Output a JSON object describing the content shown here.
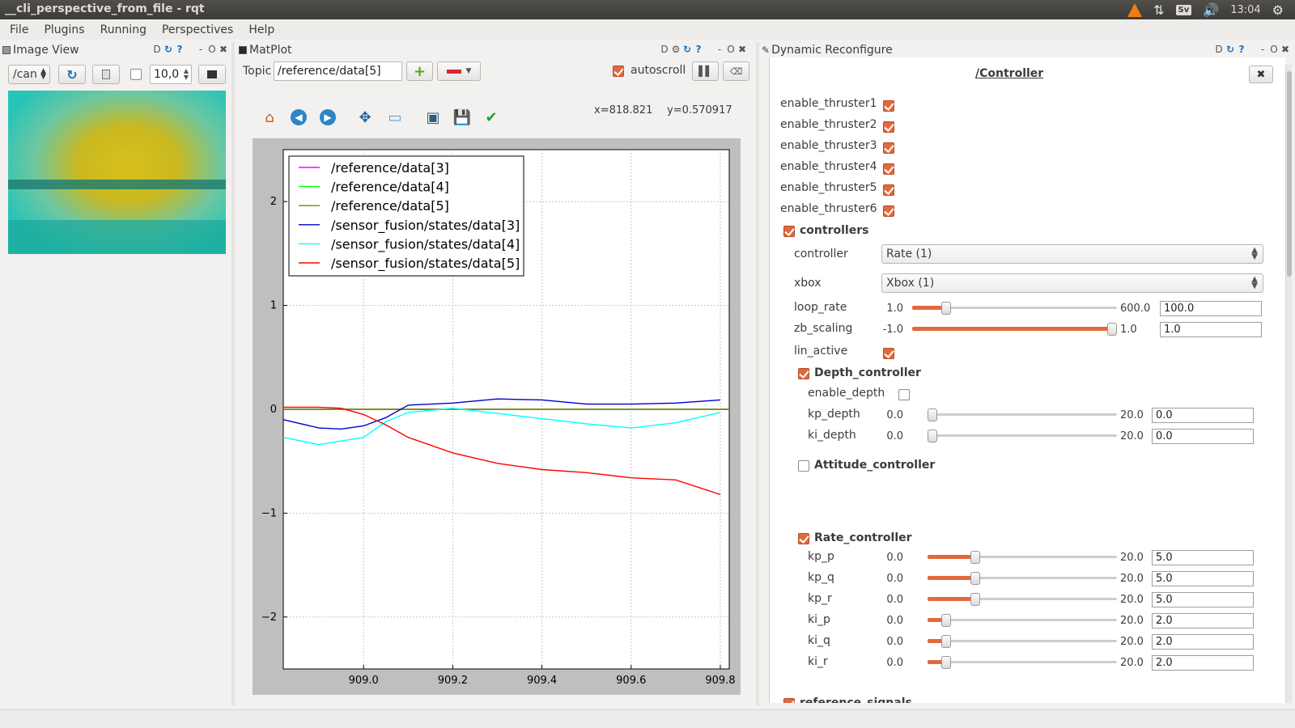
{
  "window": {
    "title": "__cli_perspective_from_file - rqt"
  },
  "tray": {
    "keyboard": "Sv",
    "clock": "13:04"
  },
  "menu": [
    "File",
    "Plugins",
    "Running",
    "Perspectives",
    "Help"
  ],
  "image_view": {
    "title": "Image View",
    "topic": "/can",
    "zoom": "10,0",
    "smooth_checked": false,
    "dock_controls": {
      "d": "D",
      "o": "O",
      "x": "✖"
    }
  },
  "matplot": {
    "title": "MatPlot",
    "topic_label": "Topic",
    "topic_value": "/reference/data[5]",
    "autoscroll_label": "autoscroll",
    "autoscroll_checked": true,
    "coord_x": "x=818.821",
    "coord_y": "y=0.570917",
    "dock_controls": {
      "d": "D",
      "o": "O",
      "x": "✖"
    }
  },
  "chart_data": {
    "type": "line",
    "xlim": [
      908.82,
      909.82
    ],
    "ylim": [
      -2.5,
      2.5
    ],
    "xticks": [
      "909.0",
      "909.2",
      "909.4",
      "909.6",
      "909.8"
    ],
    "xtick_values": [
      909.0,
      909.2,
      909.4,
      909.6,
      909.8
    ],
    "yticks": [
      "2",
      "1",
      "0",
      "−1",
      "−2"
    ],
    "ytick_values": [
      2,
      1,
      0,
      -1,
      -2
    ],
    "grid": true,
    "legend": "top-left",
    "series": [
      {
        "name": "/reference/data[3]",
        "color": "#ff00ff",
        "x": [
          908.82,
          909.82
        ],
        "y": [
          0.0,
          0.0
        ]
      },
      {
        "name": "/reference/data[4]",
        "color": "#00ff00",
        "x": [
          908.82,
          909.82
        ],
        "y": [
          0.0,
          0.0
        ]
      },
      {
        "name": "/reference/data[5]",
        "color": "#808000",
        "x": [
          908.82,
          909.82
        ],
        "y": [
          0.0,
          0.0
        ]
      },
      {
        "name": "/sensor_fusion/states/data[3]",
        "color": "#0000cc",
        "x": [
          908.82,
          908.9,
          908.95,
          909.0,
          909.05,
          909.1,
          909.2,
          909.3,
          909.4,
          909.5,
          909.6,
          909.7,
          909.8
        ],
        "y": [
          -0.1,
          -0.18,
          -0.19,
          -0.16,
          -0.08,
          0.04,
          0.06,
          0.1,
          0.09,
          0.05,
          0.05,
          0.06,
          0.09
        ]
      },
      {
        "name": "/sensor_fusion/states/data[4]",
        "color": "#00ffff",
        "x": [
          908.82,
          908.9,
          909.0,
          909.05,
          909.1,
          909.2,
          909.3,
          909.4,
          909.5,
          909.6,
          909.7,
          909.8
        ],
        "y": [
          -0.27,
          -0.34,
          -0.27,
          -0.12,
          -0.03,
          0.01,
          -0.04,
          -0.09,
          -0.14,
          -0.18,
          -0.13,
          -0.03
        ]
      },
      {
        "name": "/sensor_fusion/states/data[5]",
        "color": "#ff0000",
        "x": [
          908.82,
          908.9,
          908.95,
          909.0,
          909.05,
          909.1,
          909.2,
          909.3,
          909.4,
          909.5,
          909.6,
          909.7,
          909.8
        ],
        "y": [
          0.02,
          0.02,
          0.01,
          -0.05,
          -0.15,
          -0.27,
          -0.42,
          -0.52,
          -0.58,
          -0.61,
          -0.66,
          -0.68,
          -0.82
        ]
      }
    ]
  },
  "dynamic_reconfigure": {
    "title": "Dynamic Reconfigure",
    "node": "/Controller",
    "dock_controls": {
      "d": "D",
      "o": "O",
      "x": "✖"
    },
    "thrusters": [
      {
        "label": "enable_thruster1",
        "checked": true
      },
      {
        "label": "enable_thruster2",
        "checked": true
      },
      {
        "label": "enable_thruster3",
        "checked": true
      },
      {
        "label": "enable_thruster4",
        "checked": true
      },
      {
        "label": "enable_thruster5",
        "checked": true
      },
      {
        "label": "enable_thruster6",
        "checked": true
      }
    ],
    "controllers": {
      "label": "controllers",
      "checked": true,
      "controller_label": "controller",
      "controller_value": "Rate (1)",
      "xbox_label": "xbox",
      "xbox_value": "Xbox (1)",
      "loop_rate": {
        "label": "loop_rate",
        "min": "1.0",
        "max": "600.0",
        "value": "100.0",
        "fraction": 0.165
      },
      "zb_scaling": {
        "label": "zb_scaling",
        "min": "-1.0",
        "max": "1.0",
        "value": "1.0",
        "fraction": 1.0
      },
      "lin_active": {
        "label": "lin_active",
        "checked": true
      }
    },
    "depth_controller": {
      "label": "Depth_controller",
      "checked": true,
      "enable_depth": {
        "label": "enable_depth",
        "checked": false
      },
      "params": [
        {
          "label": "kp_depth",
          "min": "0.0",
          "max": "20.0",
          "value": "0.0",
          "fraction": 0.0
        },
        {
          "label": "ki_depth",
          "min": "0.0",
          "max": "20.0",
          "value": "0.0",
          "fraction": 0.0
        }
      ]
    },
    "attitude_controller": {
      "label": "Attitude_controller",
      "checked": false
    },
    "rate_controller": {
      "label": "Rate_controller",
      "checked": true,
      "params": [
        {
          "label": "kp_p",
          "min": "0.0",
          "max": "20.0",
          "value": "5.0",
          "fraction": 0.25
        },
        {
          "label": "kp_q",
          "min": "0.0",
          "max": "20.0",
          "value": "5.0",
          "fraction": 0.25
        },
        {
          "label": "kp_r",
          "min": "0.0",
          "max": "20.0",
          "value": "5.0",
          "fraction": 0.25
        },
        {
          "label": "ki_p",
          "min": "0.0",
          "max": "20.0",
          "value": "2.0",
          "fraction": 0.1
        },
        {
          "label": "ki_q",
          "min": "0.0",
          "max": "20.0",
          "value": "2.0",
          "fraction": 0.1
        },
        {
          "label": "ki_r",
          "min": "0.0",
          "max": "20.0",
          "value": "2.0",
          "fraction": 0.1
        }
      ]
    },
    "reference_signals": {
      "label": "reference_signals",
      "checked": true
    }
  }
}
